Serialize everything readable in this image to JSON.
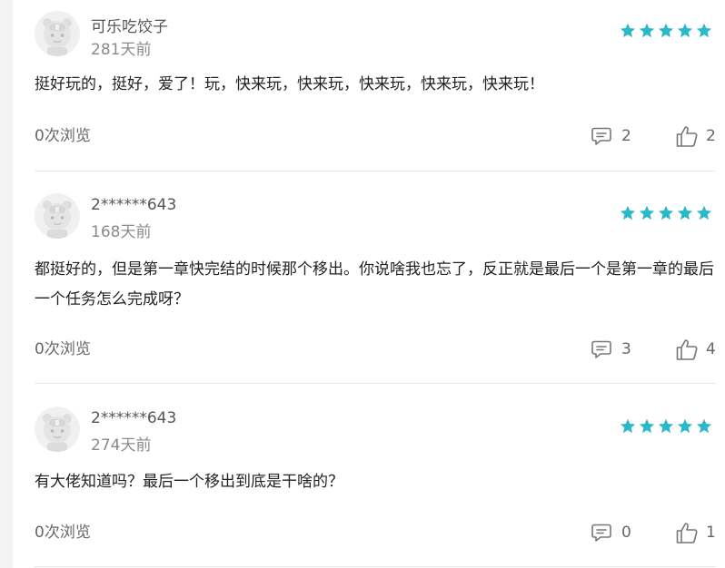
{
  "colors": {
    "star": "#2bb8c9",
    "divider": "#e8e8e8",
    "username": "#555555",
    "muted": "#8a8a8a"
  },
  "reviews": [
    {
      "username": "可乐吃饺子",
      "time": "281天前",
      "rating": 5,
      "content": "挺好玩的，挺好，爱了！玩，快来玩，快来玩，快来玩，快来玩，快来玩！",
      "views": "0次浏览",
      "comments": "2",
      "likes": "2"
    },
    {
      "username": "2******643",
      "time": "168天前",
      "rating": 5,
      "content": "都挺好的，但是第一章快完结的时候那个移出。你说啥我也忘了，反正就是最后一个是第一章的最后一个任务怎么完成呀？",
      "views": "0次浏览",
      "comments": "3",
      "likes": "4"
    },
    {
      "username": "2******643",
      "time": "274天前",
      "rating": 5,
      "content": "有大佬知道吗？最后一个移出到底是干啥的？",
      "views": "0次浏览",
      "comments": "0",
      "likes": "1"
    }
  ]
}
